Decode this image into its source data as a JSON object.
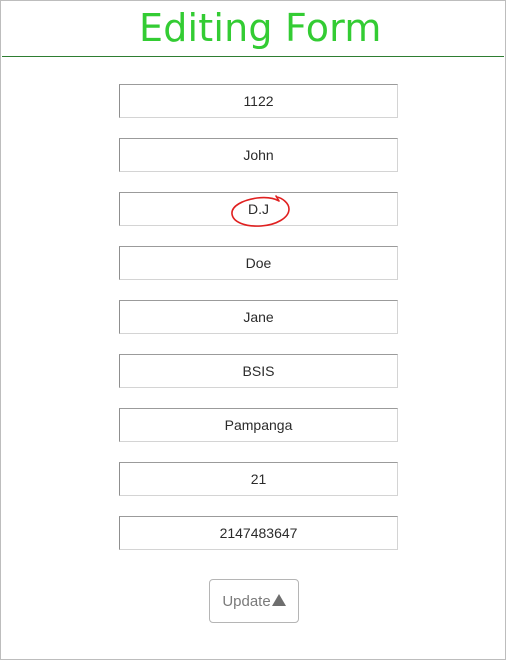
{
  "header": {
    "title": "Editing Form"
  },
  "form": {
    "fields": [
      {
        "name": "id-field",
        "value": "1122"
      },
      {
        "name": "first-name-field",
        "value": "John"
      },
      {
        "name": "middle-name-field",
        "value": "D.J"
      },
      {
        "name": "last-name-field",
        "value": "Doe"
      },
      {
        "name": "nickname-field",
        "value": "Jane"
      },
      {
        "name": "course-field",
        "value": "BSIS"
      },
      {
        "name": "address-field",
        "value": "Pampanga"
      },
      {
        "name": "age-field",
        "value": "21"
      },
      {
        "name": "contact-number-field",
        "value": "2147483647"
      }
    ],
    "update_label": "Update",
    "update_icon": "arrow-up-icon"
  },
  "colors": {
    "title": "#33cc33",
    "title_rule": "#2e7d32",
    "annotation": "#e02020"
  }
}
